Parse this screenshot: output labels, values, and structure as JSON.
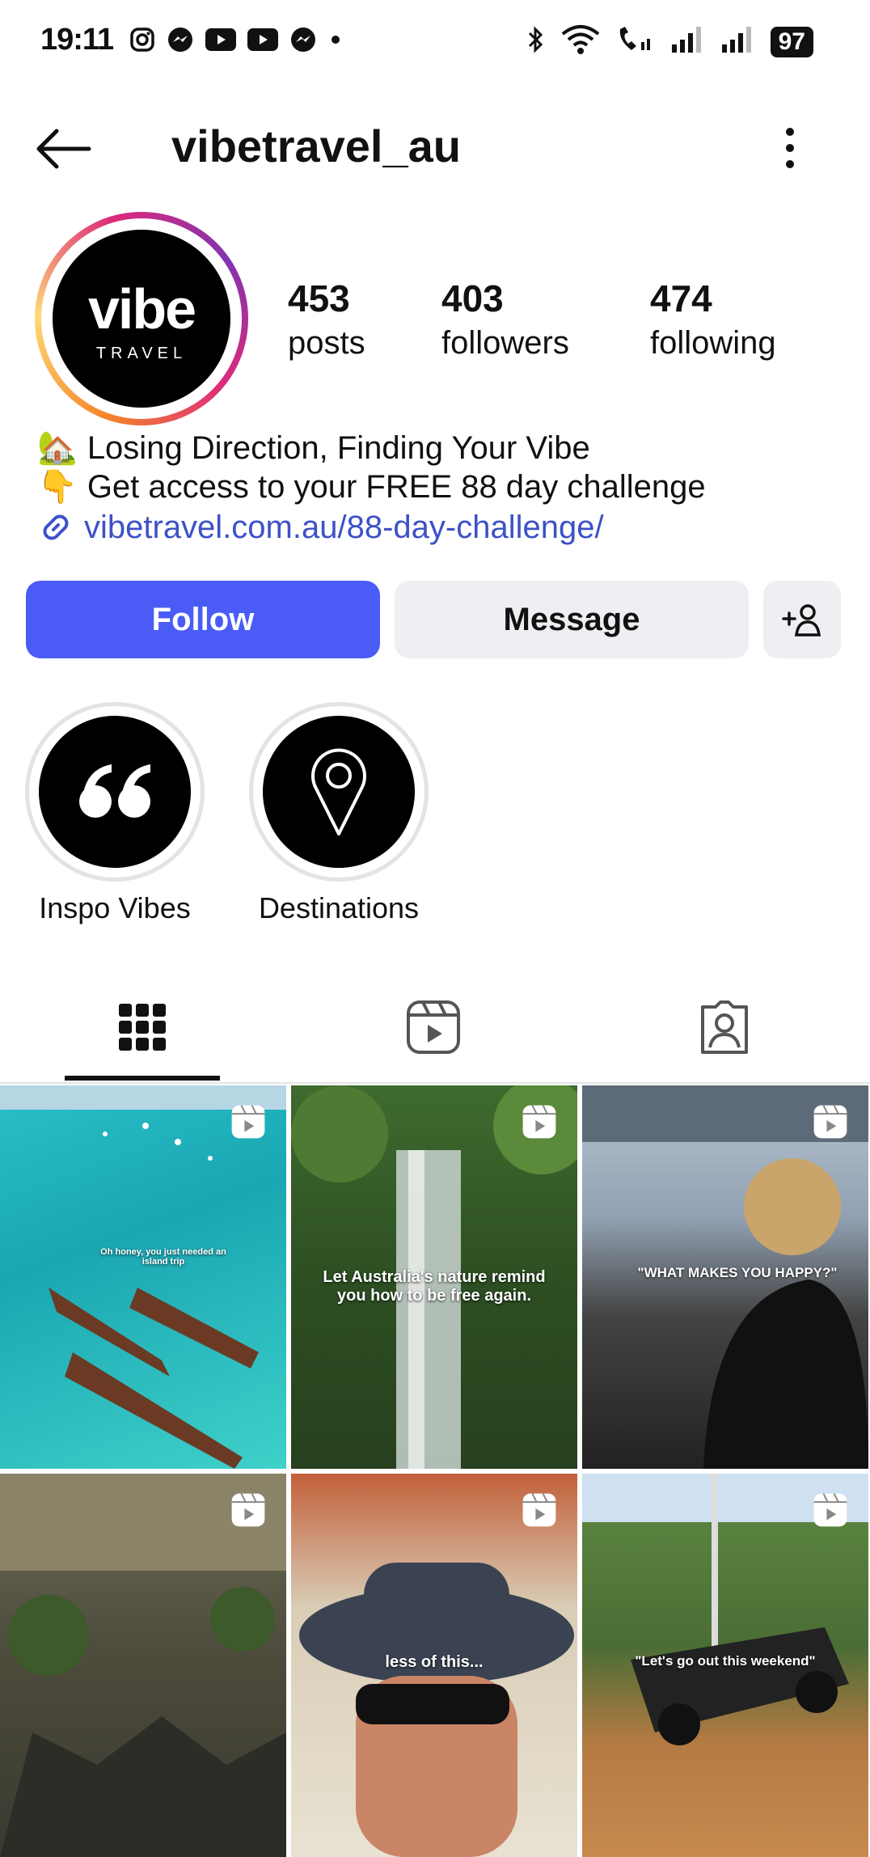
{
  "status_bar": {
    "time": "19:11",
    "battery": "97",
    "left_icons": [
      "instagram-icon",
      "messenger-icon",
      "youtube-icon",
      "youtube-icon",
      "messenger-icon",
      "dot-icon"
    ],
    "right_icons": [
      "bluetooth-icon",
      "wifi-icon",
      "wifi-call-icon",
      "signal-icon",
      "signal-icon"
    ]
  },
  "header": {
    "username": "vibetravel_au"
  },
  "avatar": {
    "brand": "vibe",
    "sub": "TRAVEL"
  },
  "stats": [
    {
      "num": "453",
      "label": "posts"
    },
    {
      "num": "403",
      "label": "followers"
    },
    {
      "num": "474",
      "label": "following"
    }
  ],
  "bio": {
    "line1_emoji": "🏡",
    "line1": "Losing Direction, Finding Your Vibe",
    "line2_emoji": "👇",
    "line2": "Get access to your FREE 88 day challenge",
    "link": "vibetravel.com.au/88-day-challenge/"
  },
  "buttons": {
    "follow": "Follow",
    "message": "Message"
  },
  "highlights": [
    {
      "label": "Inspo Vibes",
      "icon": "quote-icon"
    },
    {
      "label": "Destinations",
      "icon": "location-pin-icon"
    }
  ],
  "tabs": [
    "grid-icon",
    "reels-icon",
    "tagged-icon"
  ],
  "posts": [
    {
      "caption": "Oh honey, you just needed an island trip"
    },
    {
      "caption": "Let Australia's nature remind you how to be free again."
    },
    {
      "caption": "\"WHAT MAKES YOU HAPPY?\""
    },
    {
      "caption": ""
    },
    {
      "caption": "less of this..."
    },
    {
      "caption": "\"Let's go out this weekend\""
    }
  ],
  "colors": {
    "follow_button": "#4a5cf5",
    "link": "#3d51c7",
    "secondary_button": "#efeff3"
  }
}
